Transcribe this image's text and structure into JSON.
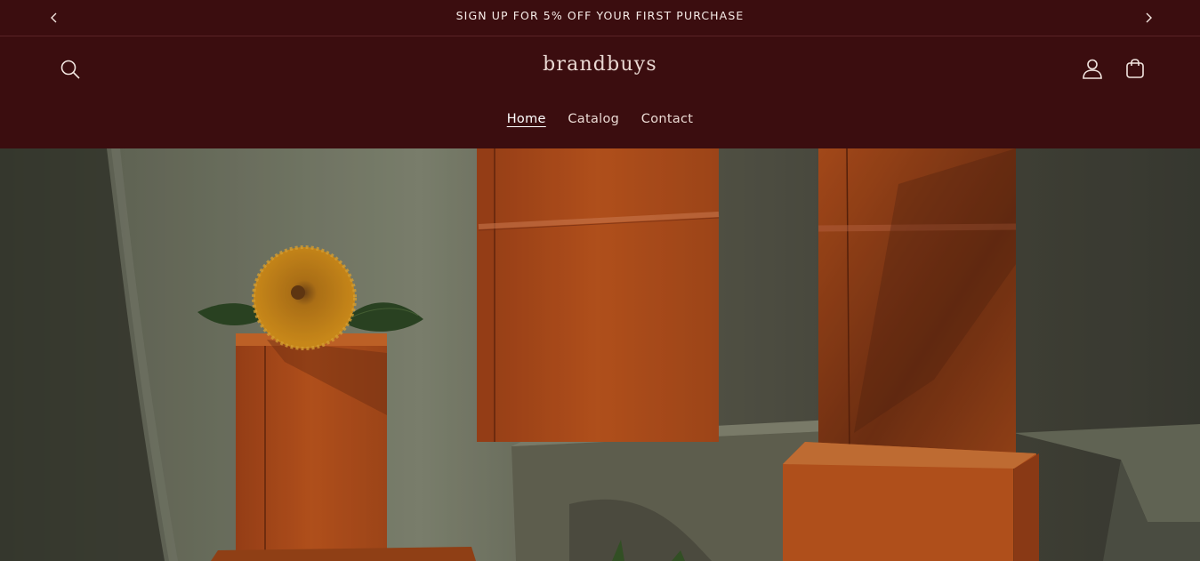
{
  "announcement": {
    "text": "SIGN UP FOR 5% OFF YOUR FIRST PURCHASE",
    "prev_icon": "chevron-left-icon",
    "next_icon": "chevron-right-icon"
  },
  "header": {
    "logo": "brandbuys",
    "search_icon": "search-icon",
    "account_icon": "account-icon",
    "cart_icon": "cart-icon"
  },
  "nav": {
    "items": [
      {
        "label": "Home",
        "active": true
      },
      {
        "label": "Catalog",
        "active": false
      },
      {
        "label": "Contact",
        "active": false
      }
    ]
  },
  "colors": {
    "header_bg": "#3b0d0f",
    "text": "#f3e6e1",
    "box_orange": "#c85a1c"
  }
}
